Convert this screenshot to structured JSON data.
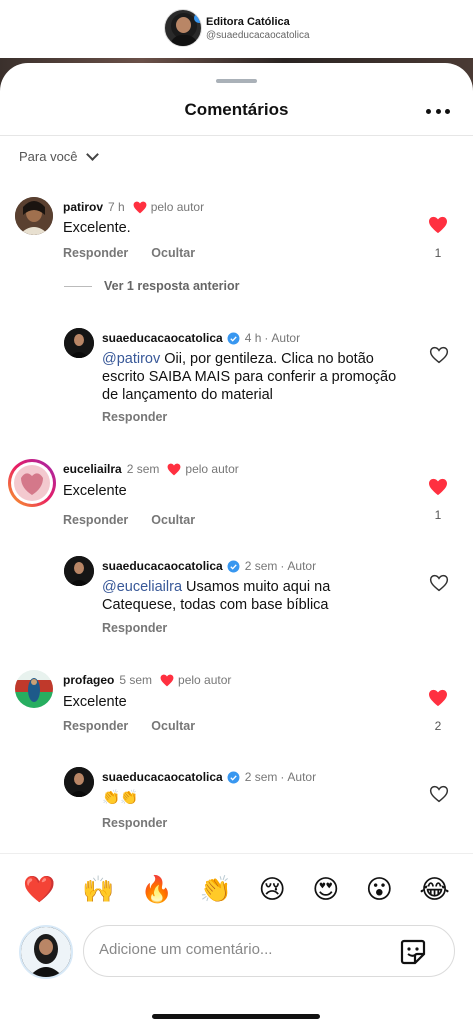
{
  "header": {
    "account_name": "Editora Católica",
    "account_handle": "@suaeducacaocatolica"
  },
  "sheet": {
    "title": "Comentários",
    "filter_label": "Para você"
  },
  "comments": [
    {
      "username": "patirov",
      "time": "7 h",
      "by_author": "pelo autor",
      "text": "Excelente.",
      "reply_label": "Responder",
      "hide_label": "Ocultar",
      "likes": "1"
    },
    {
      "username": "euceliailra",
      "time": "2 sem",
      "by_author": "pelo autor",
      "text": "Excelente",
      "reply_label": "Responder",
      "hide_label": "Ocultar",
      "likes": "1"
    },
    {
      "username": "profageo",
      "time": "5 sem",
      "by_author": "pelo autor",
      "text": "Excelente",
      "reply_label": "Responder",
      "hide_label": "Ocultar",
      "likes": "2"
    }
  ],
  "view_previous": "Ver 1 resposta anterior",
  "replies": [
    {
      "username": "suaeducacaocatolica",
      "time": "4 h",
      "author_tag": "Autor",
      "mention": "@patirov",
      "text": " Oii, por gentileza. Clica no botão escrito SAIBA MAIS para conferir a promoção de lançamento do material",
      "reply_label": "Responder"
    },
    {
      "username": "suaeducacaocatolica",
      "time": "2 sem",
      "author_tag": "Autor",
      "mention": "@euceliailra",
      "text": " Usamos muito aqui na Catequese, todas com base bíblica",
      "reply_label": "Responder"
    },
    {
      "username": "suaeducacaocatolica",
      "time": "2 sem",
      "author_tag": "Autor",
      "mention": "",
      "text": "👏👏",
      "reply_label": "Responder"
    }
  ],
  "emoji_bar": [
    "❤️",
    "🙌",
    "🔥",
    "👏",
    "😢",
    "😍",
    "😮",
    "😂"
  ],
  "composer": {
    "placeholder": "Adicione um comentário..."
  },
  "colors": {
    "like_red": "#ff3040",
    "verified_blue": "#3897f0",
    "mention_blue": "#385898"
  }
}
